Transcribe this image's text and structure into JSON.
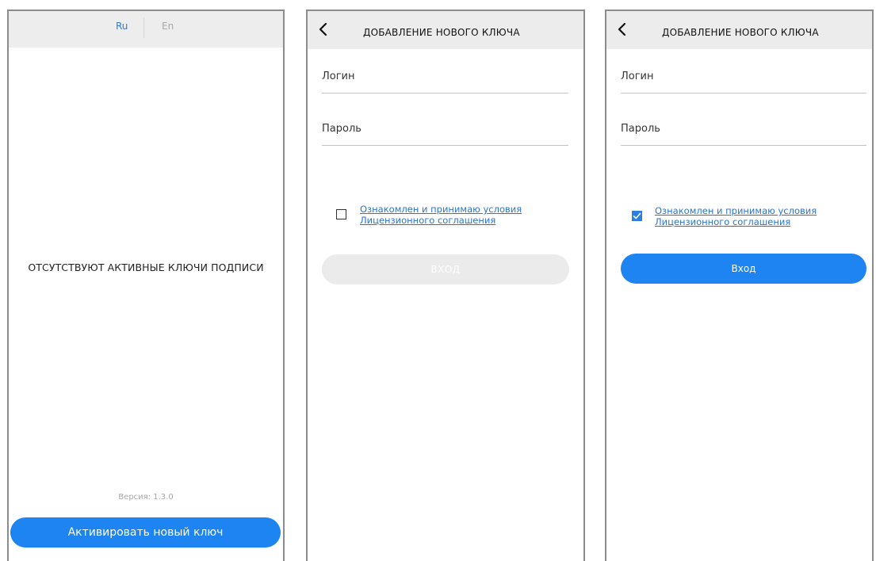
{
  "screen1": {
    "lang_ru": "Ru",
    "lang_en": "En",
    "empty_message": "ОТСУТСТВУЮТ АКТИВНЫЕ КЛЮЧИ ПОДПИСИ",
    "version": "Версия: 1.3.0",
    "activate_label": "Активировать новый ключ"
  },
  "screen2": {
    "title": "ДОБАВЛЕНИЕ НОВОГО КЛЮЧА",
    "login_label": "Логин",
    "password_label": "Пароль",
    "agree_line1": "Ознакомлен и принимаю условия",
    "agree_line2": "Лицензионного соглашения",
    "agree_checked": false,
    "enter_label": "ВХОД"
  },
  "screen3": {
    "title": "ДОБАВЛЕНИЕ НОВОГО КЛЮЧА",
    "login_label": "Логин",
    "password_label": "Пароль",
    "agree_line1": "Ознакомлен и принимаю условия",
    "agree_line2": "Лицензионного соглашения",
    "agree_checked": true,
    "enter_label": "Вход"
  },
  "colors": {
    "accent": "#1e84f1",
    "link": "#2f74c8",
    "header_bg": "#ececec",
    "disabled_btn": "#ebebeb"
  },
  "icons": {
    "back": "chevron-left-icon",
    "check": "checkmark-icon"
  }
}
